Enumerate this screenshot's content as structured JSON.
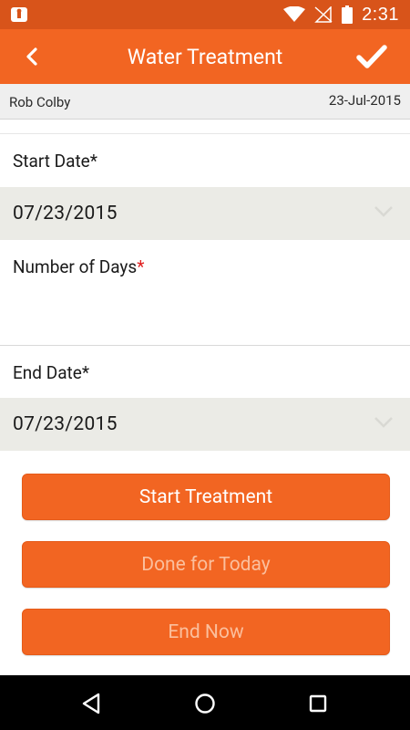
{
  "status_bar": {
    "time": "2:31",
    "icons": [
      "notification-icon",
      "wifi-icon",
      "no-signal-icon",
      "battery-icon"
    ]
  },
  "app_bar": {
    "title": "Water Treatment",
    "back_icon": "chevron-left-icon",
    "confirm_icon": "checkmark-icon"
  },
  "user_bar": {
    "name": "Rob Colby",
    "date": "23-Jul-2015"
  },
  "form": {
    "start_date": {
      "label": "Start Date",
      "required_marker": "*",
      "value": "07/23/2015"
    },
    "number_of_days": {
      "label": "Number of Days",
      "required_marker": "*",
      "value": ""
    },
    "end_date": {
      "label": "End Date",
      "required_marker": "*",
      "value": "07/23/2015"
    }
  },
  "buttons": {
    "start_treatment": "Start Treatment",
    "done_for_today": "Done for Today",
    "end_now": "End Now"
  },
  "colors": {
    "status_bar": "#d8541a",
    "accent": "#f26522",
    "required_red": "#e02020",
    "disabled_text": "#fbbf9d"
  },
  "nav_bar": {
    "icons": [
      "back-triangle-icon",
      "home-circle-icon",
      "recents-square-icon"
    ]
  }
}
